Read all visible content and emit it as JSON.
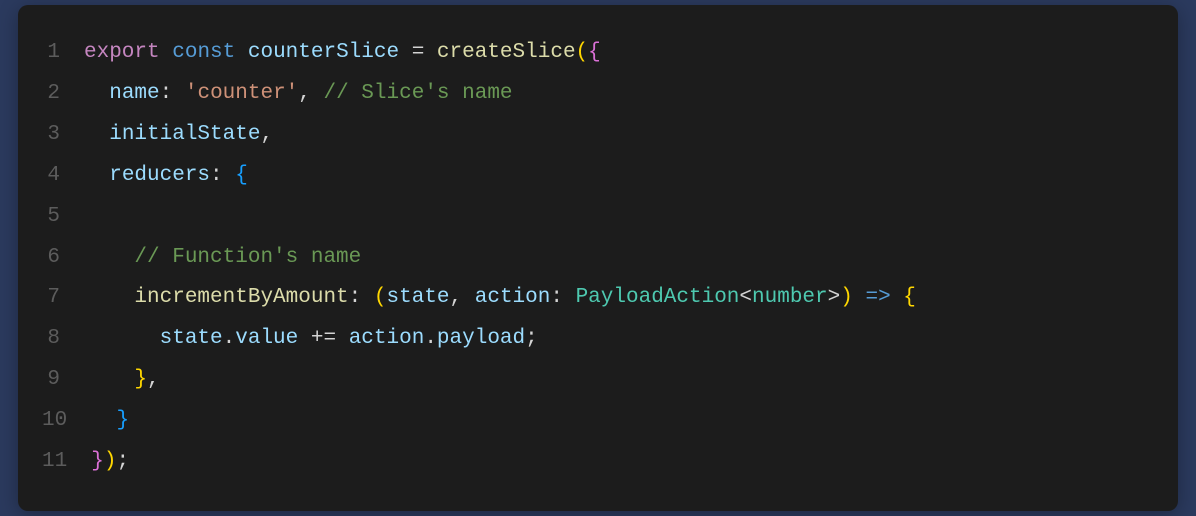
{
  "code": {
    "lines": [
      {
        "num": "1",
        "tokens": [
          {
            "cls": "kw-export",
            "text": "export"
          },
          {
            "cls": "plain",
            "text": " "
          },
          {
            "cls": "kw-const",
            "text": "const"
          },
          {
            "cls": "plain",
            "text": " "
          },
          {
            "cls": "ident",
            "text": "counterSlice"
          },
          {
            "cls": "plain",
            "text": " "
          },
          {
            "cls": "op",
            "text": "="
          },
          {
            "cls": "plain",
            "text": " "
          },
          {
            "cls": "func-call",
            "text": "createSlice"
          },
          {
            "cls": "brace",
            "text": "("
          },
          {
            "cls": "brace-pink",
            "text": "{"
          }
        ]
      },
      {
        "num": "2",
        "tokens": [
          {
            "cls": "plain",
            "text": "  "
          },
          {
            "cls": "prop",
            "text": "name"
          },
          {
            "cls": "plain",
            "text": ": "
          },
          {
            "cls": "str",
            "text": "'counter'"
          },
          {
            "cls": "plain",
            "text": ", "
          },
          {
            "cls": "comment",
            "text": "// Slice's name"
          }
        ]
      },
      {
        "num": "3",
        "tokens": [
          {
            "cls": "plain",
            "text": "  "
          },
          {
            "cls": "prop",
            "text": "initialState"
          },
          {
            "cls": "plain",
            "text": ","
          }
        ]
      },
      {
        "num": "4",
        "tokens": [
          {
            "cls": "plain",
            "text": "  "
          },
          {
            "cls": "prop",
            "text": "reducers"
          },
          {
            "cls": "plain",
            "text": ": "
          },
          {
            "cls": "brace-blue",
            "text": "{"
          }
        ]
      },
      {
        "num": "5",
        "tokens": []
      },
      {
        "num": "6",
        "tokens": [
          {
            "cls": "plain",
            "text": "    "
          },
          {
            "cls": "comment",
            "text": "// Function's name"
          }
        ]
      },
      {
        "num": "7",
        "tokens": [
          {
            "cls": "plain",
            "text": "    "
          },
          {
            "cls": "fn-name",
            "text": "incrementByAmount"
          },
          {
            "cls": "plain",
            "text": ": "
          },
          {
            "cls": "brace",
            "text": "("
          },
          {
            "cls": "param",
            "text": "state"
          },
          {
            "cls": "plain",
            "text": ", "
          },
          {
            "cls": "param",
            "text": "action"
          },
          {
            "cls": "plain",
            "text": ": "
          },
          {
            "cls": "type",
            "text": "PayloadAction"
          },
          {
            "cls": "angle",
            "text": "<"
          },
          {
            "cls": "type",
            "text": "number"
          },
          {
            "cls": "angle",
            "text": ">"
          },
          {
            "cls": "brace",
            "text": ")"
          },
          {
            "cls": "plain",
            "text": " "
          },
          {
            "cls": "kw-const",
            "text": "=>"
          },
          {
            "cls": "plain",
            "text": " "
          },
          {
            "cls": "brace",
            "text": "{"
          }
        ]
      },
      {
        "num": "8",
        "tokens": [
          {
            "cls": "plain",
            "text": "      "
          },
          {
            "cls": "param",
            "text": "state"
          },
          {
            "cls": "plain",
            "text": "."
          },
          {
            "cls": "prop",
            "text": "value"
          },
          {
            "cls": "plain",
            "text": " += "
          },
          {
            "cls": "param",
            "text": "action"
          },
          {
            "cls": "plain",
            "text": "."
          },
          {
            "cls": "prop",
            "text": "payload"
          },
          {
            "cls": "plain",
            "text": ";"
          }
        ]
      },
      {
        "num": "9",
        "tokens": [
          {
            "cls": "plain",
            "text": "    "
          },
          {
            "cls": "brace",
            "text": "}"
          },
          {
            "cls": "plain",
            "text": ","
          }
        ]
      },
      {
        "num": "10",
        "tokens": [
          {
            "cls": "plain",
            "text": "  "
          },
          {
            "cls": "brace-blue",
            "text": "}"
          }
        ]
      },
      {
        "num": "11",
        "tokens": [
          {
            "cls": "brace-pink",
            "text": "}"
          },
          {
            "cls": "brace",
            "text": ")"
          },
          {
            "cls": "plain",
            "text": ";"
          }
        ]
      }
    ]
  }
}
